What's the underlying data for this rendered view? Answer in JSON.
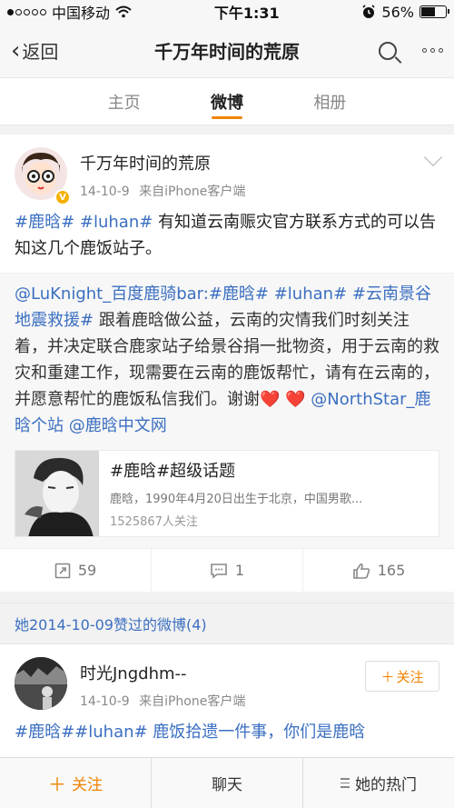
{
  "status": {
    "carrier": "中国移动",
    "time": "下午1:31",
    "battery": "56%",
    "battery_level": 0.56
  },
  "nav": {
    "back_label": "返回",
    "title": "千万年时间的荒原"
  },
  "tabs": [
    {
      "label": "主页"
    },
    {
      "label": "微博"
    },
    {
      "label": "相册"
    }
  ],
  "post": {
    "author": "千万年时间的荒原",
    "date": "14-10-9",
    "source": "来自iPhone客户端",
    "tag1": "#鹿晗#",
    "tag2": "#luhan#",
    "text": " 有知道云南赈灾官方联系方式的可以告知这几个鹿饭站子。",
    "repost": {
      "mention": "@LuKnight_百度鹿骑bar",
      "colon": ":",
      "tags": "#鹿晗# #luhan# #云南景谷地震救援#",
      "text": " 跟着鹿晗做公益，云南的灾情我们时刻关注着，并决定联合鹿家站子给景谷捐一批物资，用于云南的救灾和重建工作，现需要在云南的鹿饭帮忙，请有在云南的，并愿意帮忙的鹿饭私信我们。谢谢",
      "hearts": "❤️ ❤️",
      "mention2": "@NorthStar_鹿晗个站",
      "mention3": "@鹿晗中文网"
    },
    "topic": {
      "title": "#鹿晗#超级话题",
      "desc": "鹿晗，1990年4月20日出生于北京，中国男歌...",
      "follows": "1525867人关注"
    },
    "actions": {
      "repost_count": "59",
      "comment_count": "1",
      "like_count": "165"
    }
  },
  "liked_header": "她2014-10-09赞过的微博(4)",
  "post2": {
    "author": "时光Jngdhm--",
    "date": "14-10-9",
    "source": "来自iPhone客户端",
    "follow_label": "关注",
    "preview_text": "#鹿晗##luhan# 鹿饭拾遗一件事，你们是鹿晗"
  },
  "bottom": {
    "follow": "关注",
    "chat": "聊天",
    "hot": "她的热门"
  },
  "colors": {
    "accent": "#f08300",
    "link": "#3b6fc1"
  }
}
